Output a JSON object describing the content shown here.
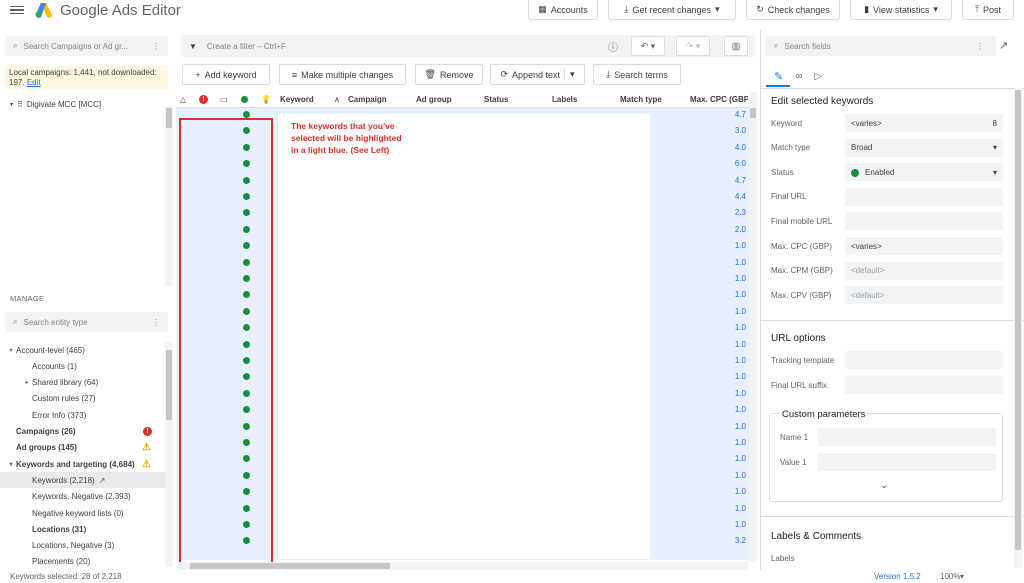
{
  "app": {
    "title": "Google Ads Editor"
  },
  "toolbar": {
    "accounts": "Accounts",
    "get_recent": "Get recent changes",
    "check": "Check changes",
    "view_stats": "View statistics",
    "post": "Post"
  },
  "left": {
    "search_placeholder": "Search Campaigns or Ad gr...",
    "local_text": "Local campaigns: 1,441, not downloaded: 197.",
    "local_link": "Edit",
    "account": "Digivate MCC [MCC]",
    "manage": "MANAGE",
    "entity_placeholder": "Search entity type",
    "entities": [
      {
        "label": "Account-level (465)",
        "caret": "▾"
      },
      {
        "label": "Accounts (1)"
      },
      {
        "label": "Shared library (64)",
        "caret": "▸"
      },
      {
        "label": "Custom rules (27)"
      },
      {
        "label": "Error Info (373)"
      },
      {
        "label": "Campaigns (26)"
      },
      {
        "label": "Ad groups (145)"
      },
      {
        "label": "Keywords and targeting (4,684)",
        "caret": "▾"
      },
      {
        "label": "Keywords (2,218)"
      },
      {
        "label": "Keywords, Negative (2,393)"
      },
      {
        "label": "Negative keyword lists (0)"
      },
      {
        "label": "Locations (31)"
      },
      {
        "label": "Locations, Negative (3)"
      },
      {
        "label": "Placements (20)"
      }
    ]
  },
  "center": {
    "filter_placeholder": "Create a filter – Ctrl+F",
    "add_keyword": "Add keyword",
    "make_multiple": "Make multiple changes",
    "remove": "Remove",
    "append_text": "Append text",
    "search_terms": "Search terms",
    "columns": [
      "Keyword",
      "Campaign",
      "Ad group",
      "Status",
      "Labels",
      "Match type",
      "Max. CPC (GBP)"
    ],
    "cpc_values": [
      "4.7",
      "3.0",
      "4.0",
      "6.0",
      "4.7",
      "4.4",
      "2.3",
      "2.0",
      "1.0",
      "1.0",
      "1.0",
      "1.0",
      "1.0",
      "1.0",
      "1.0",
      "1.0",
      "1.0",
      "1.0",
      "1.0",
      "1.0",
      "1.0",
      "1.0",
      "1.0",
      "1.0",
      "1.0",
      "1.0",
      "3.2"
    ],
    "note": "The keywords that you've selected will be highlighted in a light blue. (See Left)"
  },
  "right": {
    "search_placeholder": "Search fields",
    "edit_title": "Edit selected keywords",
    "fields": [
      {
        "label": "Keyword",
        "value": "<varies>",
        "extra": "8"
      },
      {
        "label": "Match type",
        "value": "Broad",
        "extra": "▾"
      },
      {
        "label": "Status",
        "value": "Enabled",
        "extra": "▾"
      },
      {
        "label": "Final URL",
        "value": "",
        "extra": ""
      },
      {
        "label": "Final mobile URL",
        "value": "",
        "extra": ""
      },
      {
        "label": "Max. CPC (GBP)",
        "value": "<varies>",
        "extra": ""
      },
      {
        "label": "Max. CPM (GBP)",
        "value": "<default>",
        "extra": ""
      },
      {
        "label": "Max. CPV (GBP)",
        "value": "<default>",
        "extra": ""
      }
    ],
    "url_options": "URL options",
    "tracking": "Tracking template",
    "suffix": "Final URL suffix",
    "custom_params": "Custom parameters",
    "name1": "Name 1",
    "value1": "Value 1",
    "labels_comments": "Labels & Comments",
    "labels": "Labels"
  },
  "status": {
    "selected": "Keywords selected: 28 of 2,218",
    "version": "Version 1.5.2",
    "zoom": "100%"
  }
}
